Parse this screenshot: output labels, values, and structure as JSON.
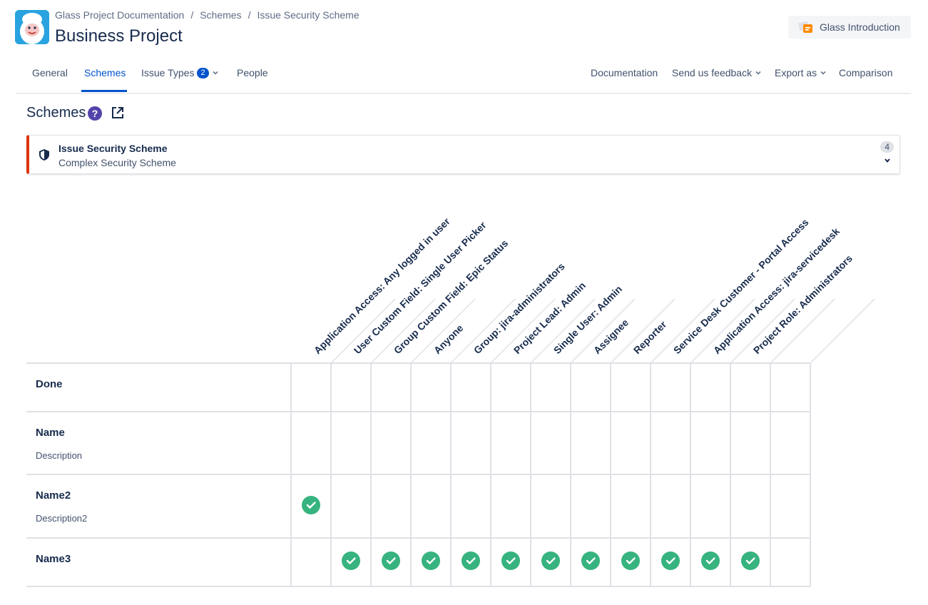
{
  "breadcrumb": [
    "Glass Project Documentation",
    "Schemes",
    "Issue Security Scheme"
  ],
  "project": {
    "title": "Business Project"
  },
  "intro_button": {
    "label": "Glass Introduction"
  },
  "nav": {
    "tabs": [
      "General",
      "Schemes",
      "Issue Types",
      "People"
    ],
    "issue_types_count": "2",
    "right": [
      "Documentation",
      "Send us feedback",
      "Export as",
      "Comparison"
    ]
  },
  "section": {
    "title": "Schemes"
  },
  "scheme_card": {
    "title": "Issue Security Scheme",
    "subtitle": "Complex Security Scheme",
    "count": "4"
  },
  "matrix": {
    "columns": [
      "Application Access: Any logged in user",
      "User Custom Field: Single User Picker",
      "Group Custom Field: Epic Status",
      "Anyone",
      "Group: jira-administrators",
      "Project Lead: Admin",
      "Single User: Admin",
      "Assignee",
      "Reporter",
      "Service Desk Customer - Portal Access",
      "Application Access: jira-servicedesk",
      "Project Role: Administrators"
    ],
    "rows": [
      {
        "name": "Done",
        "description": "",
        "checks": [
          false,
          false,
          false,
          false,
          false,
          false,
          false,
          false,
          false,
          false,
          false,
          false
        ]
      },
      {
        "name": "Name",
        "description": "Description",
        "checks": [
          false,
          false,
          false,
          false,
          false,
          false,
          false,
          false,
          false,
          false,
          false,
          false
        ]
      },
      {
        "name": "Name2",
        "description": "Description2",
        "checks": [
          true,
          false,
          false,
          false,
          false,
          false,
          false,
          false,
          false,
          false,
          false,
          false
        ]
      },
      {
        "name": "Name3",
        "description": "",
        "checks": [
          false,
          true,
          true,
          true,
          true,
          true,
          true,
          true,
          true,
          true,
          true,
          true
        ]
      }
    ],
    "check_color": "#36b37e"
  }
}
